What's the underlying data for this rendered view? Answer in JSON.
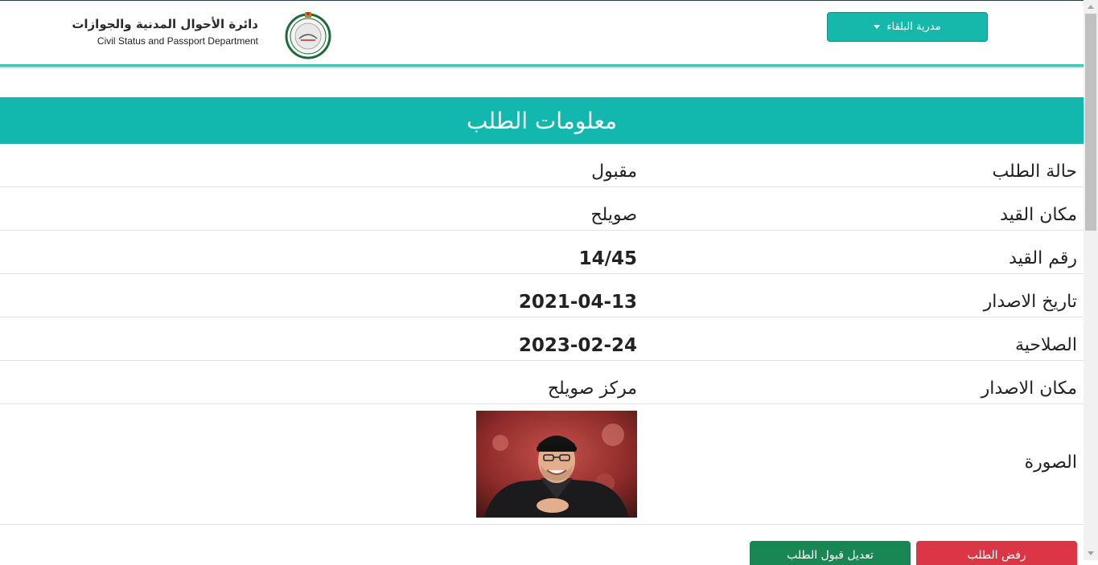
{
  "header": {
    "department_ar": "دائرة الأحوال المدنية والجوازات",
    "department_en": "Civil Status and Passport Department",
    "directorate_dropdown": "مدرية البلقاء"
  },
  "section": {
    "title": "معلومات الطلب"
  },
  "fields": [
    {
      "label": "حالة الطلب",
      "value": "مقبول"
    },
    {
      "label": "مكان القيد",
      "value": "صويلح"
    },
    {
      "label": "رقم القيد",
      "value": "14/45"
    },
    {
      "label": "تاريخ الاصدار",
      "value": "2021-04-13"
    },
    {
      "label": "الصلاحية",
      "value": "2023-02-24"
    },
    {
      "label": "مكان الاصدار",
      "value": "مركز صويلح"
    }
  ],
  "photo": {
    "label": "الصورة"
  },
  "actions": {
    "reject_label": "رفض الطلب",
    "edit_label": "تعديل قبول الطلب"
  },
  "colors": {
    "accent": "#12b8ae",
    "reject": "#dc3545",
    "edit": "#198754"
  }
}
